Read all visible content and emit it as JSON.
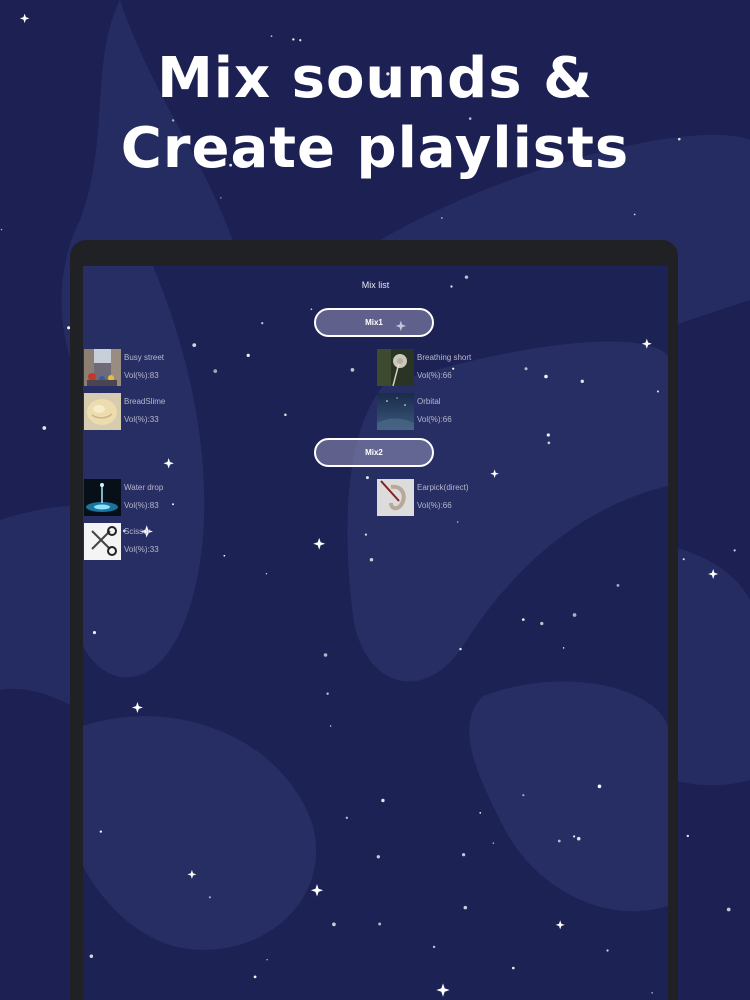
{
  "headline": {
    "line1": "Mix sounds &",
    "line2": "Create playlists"
  },
  "colors": {
    "background": "#1c2052",
    "swirl": "#283066",
    "pill_fill": "#9696b9",
    "text_light": "#b8b8cc"
  },
  "screen": {
    "title": "Mix list",
    "mixes": [
      {
        "name": "Mix1",
        "sounds": [
          {
            "name": "Busy street",
            "volume": "Vol(%):83",
            "icon": "street-photo-icon"
          },
          {
            "name": "Breathing short",
            "volume": "Vol(%):66",
            "icon": "dandelion-photo-icon"
          },
          {
            "name": "BreadSlime",
            "volume": "Vol(%):33",
            "icon": "slime-photo-icon"
          },
          {
            "name": "Orbital",
            "volume": "Vol(%):66",
            "icon": "space-photo-icon"
          }
        ]
      },
      {
        "name": "Mix2",
        "sounds": [
          {
            "name": "Water drop",
            "volume": "Vol(%):83",
            "icon": "water-drop-photo-icon"
          },
          {
            "name": "Earpick(direct)",
            "volume": "Vol(%):66",
            "icon": "earpick-photo-icon"
          },
          {
            "name": "Scissor",
            "volume": "Vol(%):33",
            "icon": "scissor-photo-icon"
          }
        ]
      }
    ]
  }
}
